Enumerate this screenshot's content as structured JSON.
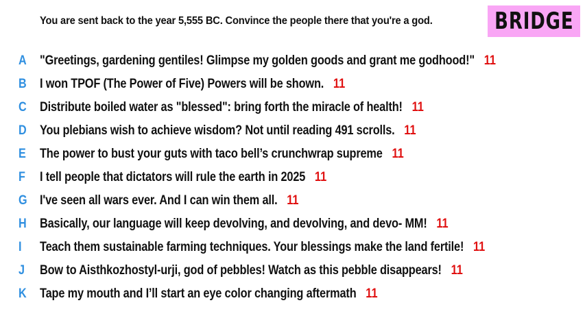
{
  "prompt": "You are sent back to the year 5,555 BC. Convince the people there that you're a god.",
  "badge": "BRIDGE",
  "colors": {
    "letter": "#2f8fe0",
    "score": "#e01010",
    "badge_bg": "#f9a6f5"
  },
  "answers": [
    {
      "letter": "A",
      "text": "\"Greetings, gardening gentiles! Glimpse my golden goods and grant me godhood!\"",
      "score": "11"
    },
    {
      "letter": "B",
      "text": "I won TPOF (The Power of Five) Powers will be shown.",
      "score": "11"
    },
    {
      "letter": "C",
      "text": "Distribute boiled water as \"blessed\": bring forth the miracle of health!",
      "score": "11"
    },
    {
      "letter": "D",
      "text": "You plebians wish to achieve wisdom? Not until reading 491 scrolls.",
      "score": "11"
    },
    {
      "letter": "E",
      "text": "The power to bust your guts with taco bell’s crunchwrap supreme",
      "score": "11"
    },
    {
      "letter": "F",
      "text": "I tell people that dictators will rule the earth in 2025",
      "score": "11"
    },
    {
      "letter": "G",
      "text": "I've seen all wars ever. And I can win them all.",
      "score": "11"
    },
    {
      "letter": "H",
      "text": "Basically, our language will keep devolving, and devolving, and devo- MM!",
      "score": "11"
    },
    {
      "letter": "I",
      "text": "Teach them sustainable farming techniques. Your blessings make the land fertile!",
      "score": "11"
    },
    {
      "letter": "J",
      "text": "Bow to Aisthkozhostyl-urji, god of pebbles! Watch as this pebble disappears!",
      "score": "11"
    },
    {
      "letter": "K",
      "text": "Tape my mouth and I’ll start an eye color changing aftermath",
      "score": "11"
    }
  ]
}
